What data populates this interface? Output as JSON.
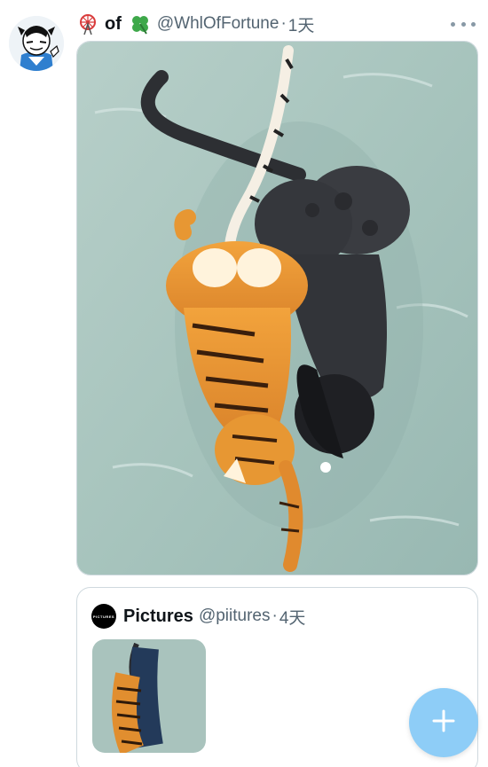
{
  "tweet": {
    "name_prefix_icon": "ferris-wheel-icon",
    "name": "of",
    "name_suffix_icon": "four-leaf-clover-icon",
    "handle": "@WhlOfFortune",
    "separator": "·",
    "time": "1天",
    "more_icon": "more-horizontal-icon",
    "avatar_icon": "zebra-character-avatar",
    "media_icon": "tiger-and-panther-artwork"
  },
  "quote": {
    "avatar_text": "PICTURES",
    "name": "Pictures",
    "handle": "@piitures",
    "separator": "·",
    "time": "4天",
    "thumb_icon": "tiger-and-panther-thumbnail"
  },
  "fab": {
    "icon": "plus-icon",
    "color": "#8ecdf7"
  },
  "colors": {
    "text_primary": "#0f1419",
    "text_secondary": "#536471",
    "border": "#cfd9de"
  }
}
